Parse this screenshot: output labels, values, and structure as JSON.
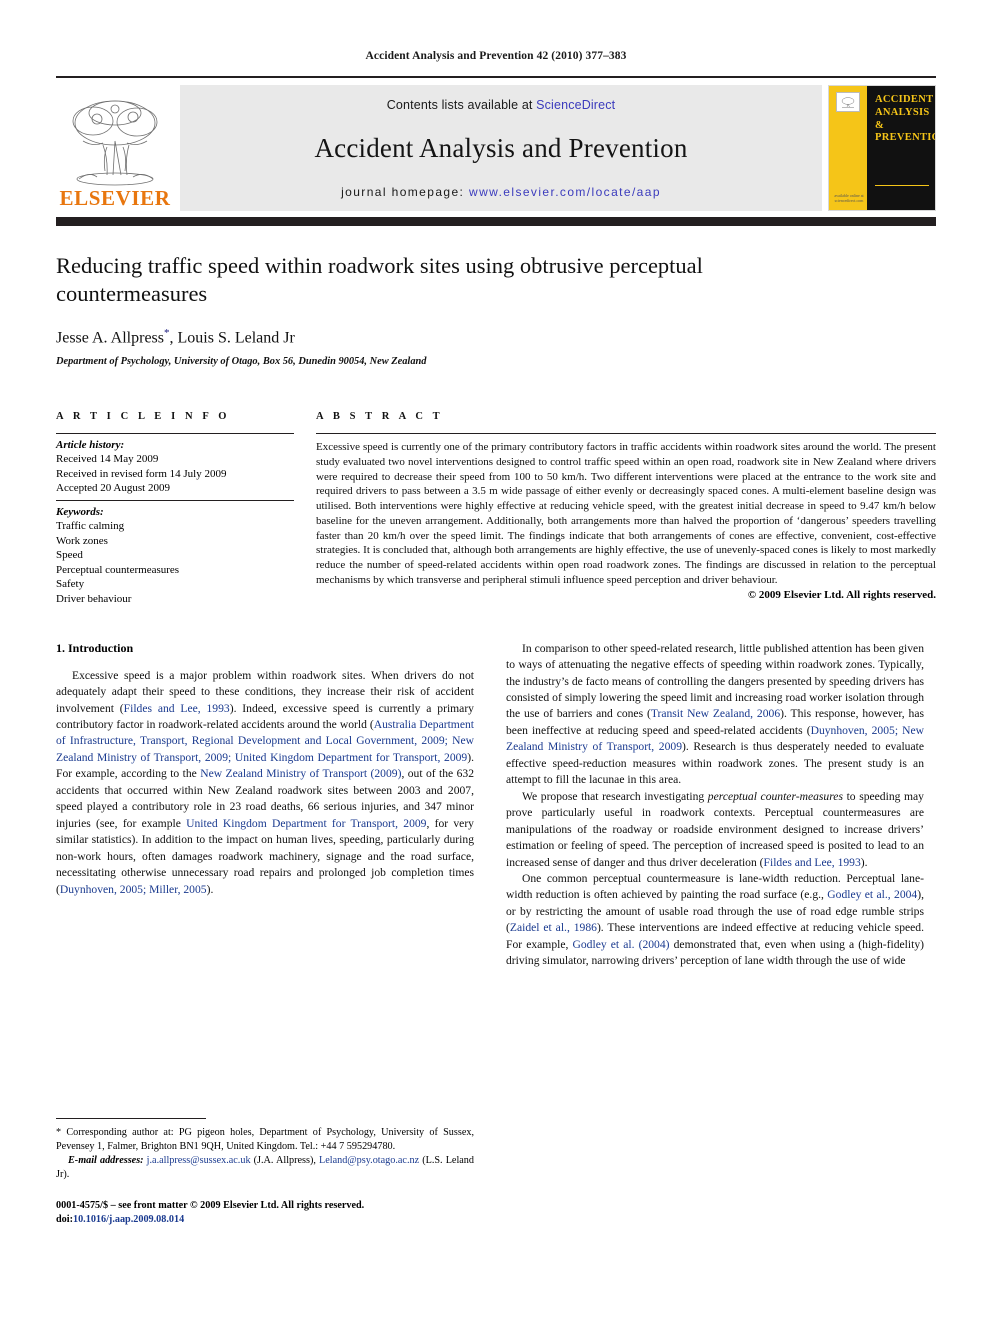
{
  "running_head": "Accident Analysis and Prevention 42 (2010) 377–383",
  "masthead": {
    "publisher_wordmark": "ELSEVIER",
    "contents_prefix": "Contents lists available at ",
    "contents_link": "ScienceDirect",
    "journal_name": "Accident Analysis and Prevention",
    "homepage_prefix": "journal homepage:",
    "homepage_url": "www.elsevier.com/locate/aap",
    "cover_title": "ACCIDENT ANALYSIS & PREVENTION",
    "cover_title_lines": [
      "ACCIDENT",
      "ANALYSIS",
      "&",
      "PREVENTION"
    ],
    "cover_badge": "ELSEVIER",
    "cover_foot": "available online at sciencedirect.com",
    "accent_orange": "#e8760e",
    "accent_yellow": "#f5c518",
    "link_blue": "#3b3bbd",
    "bar_dark": "#231f20"
  },
  "title_block": {
    "title": "Reducing traffic speed within roadwork sites using obtrusive perceptual countermeasures",
    "authors": "Jesse A. Allpress",
    "corresponding_marker": "*",
    "authors_rest": ", Louis S. Leland Jr",
    "affiliation": "Department of Psychology, University of Otago, Box 56, Dunedin 90054, New Zealand"
  },
  "article_info": {
    "label": "A R T I C L E    I N F O",
    "history_label": "Article history:",
    "history": [
      "Received 14 May 2009",
      "Received in revised form 14 July 2009",
      "Accepted 20 August 2009"
    ],
    "keywords_label": "Keywords:",
    "keywords": [
      "Traffic calming",
      "Work zones",
      "Speed",
      "Perceptual countermeasures",
      "Safety",
      "Driver behaviour"
    ]
  },
  "abstract": {
    "label": "A B S T R A C T",
    "text": "Excessive speed is currently one of the primary contributory factors in traffic accidents within roadwork sites around the world. The present study evaluated two novel interventions designed to control traffic speed within an open road, roadwork site in New Zealand where drivers were required to decrease their speed from 100 to 50 km/h. Two different interventions were placed at the entrance to the work site and required drivers to pass between a 3.5 m wide passage of either evenly or decreasingly spaced cones. A multi-element baseline design was utilised. Both interventions were highly effective at reducing vehicle speed, with the greatest initial decrease in speed to 9.47 km/h below baseline for the uneven arrangement. Additionally, both arrangements more than halved the proportion of ‘dangerous’ speeders travelling faster than 20 km/h over the speed limit. The findings indicate that both arrangements of cones are effective, convenient, cost-effective strategies. It is concluded that, although both arrangements are highly effective, the use of unevenly-spaced cones is likely to most markedly reduce the number of speed-related accidents within open road roadwork zones. The findings are discussed in relation to the perceptual mechanisms by which transverse and peripheral stimuli influence speed perception and driver behaviour.",
    "copyright": "© 2009 Elsevier Ltd. All rights reserved."
  },
  "introduction": {
    "heading": "1.  Introduction",
    "left_paragraphs": [
      {
        "segments": [
          {
            "t": "Excessive speed is a major problem within roadwork sites. When drivers do not adequately adapt their speed to these conditions, they increase their risk of accident involvement (",
            "s": "plain"
          },
          {
            "t": "Fildes and Lee, 1993",
            "s": "cite"
          },
          {
            "t": "). Indeed, excessive speed is currently a primary contributory factor in roadwork-related accidents around the world (",
            "s": "plain"
          },
          {
            "t": "Australia Department of Infrastructure, Transport, Regional Development and Local Government, 2009; New Zealand Ministry of Transport, 2009; United Kingdom Department for Transport, 2009",
            "s": "cite"
          },
          {
            "t": "). For example, according to the ",
            "s": "plain"
          },
          {
            "t": "New Zealand Ministry of Transport (2009)",
            "s": "cite"
          },
          {
            "t": ", out of the 632 accidents that occurred within New Zealand roadwork sites between 2003 and 2007, speed played a contributory role in 23 road deaths, 66 serious injuries, and 347 minor injuries (see, for example ",
            "s": "plain"
          },
          {
            "t": "United Kingdom Department for Transport, 2009",
            "s": "cite"
          },
          {
            "t": ", for very similar statistics). In addition to the impact on human lives, speeding, particularly during non-work hours, often damages roadwork machinery, signage and the road surface, necessitating otherwise unnecessary road repairs and prolonged job completion times (",
            "s": "plain"
          },
          {
            "t": "Duynhoven, 2005; Miller, 2005",
            "s": "cite"
          },
          {
            "t": ").",
            "s": "plain"
          }
        ]
      }
    ],
    "right_paragraphs": [
      {
        "segments": [
          {
            "t": "In comparison to other speed-related research, little published attention has been given to ways of attenuating the negative effects of speeding within roadwork zones. Typically, the industry’s de facto means of controlling the dangers presented by speeding drivers has consisted of simply lowering the speed limit and increasing road worker isolation through the use of barriers and cones (",
            "s": "plain"
          },
          {
            "t": "Transit New Zealand, 2006",
            "s": "cite"
          },
          {
            "t": "). This response, however, has been ineffective at reducing speed and speed-related accidents (",
            "s": "plain"
          },
          {
            "t": "Duynhoven, 2005; New Zealand Ministry of Transport, 2009",
            "s": "cite"
          },
          {
            "t": "). Research is thus desperately needed to evaluate effective speed-reduction measures within roadwork zones. The present study is an attempt to fill the lacunae in this area.",
            "s": "plain"
          }
        ]
      },
      {
        "segments": [
          {
            "t": "We propose that research investigating ",
            "s": "plain"
          },
          {
            "t": "perceptual counter-measures",
            "s": "italic"
          },
          {
            "t": " to speeding may prove particularly useful in roadwork contexts. Perceptual countermeasures are manipulations of the roadway or roadside environment designed to increase drivers’ estimation or feeling of speed. The perception of increased speed is posited to lead to an increased sense of danger and thus driver deceleration (",
            "s": "plain"
          },
          {
            "t": "Fildes and Lee, 1993",
            "s": "cite"
          },
          {
            "t": ").",
            "s": "plain"
          }
        ]
      },
      {
        "segments": [
          {
            "t": "One common perceptual countermeasure is lane-width reduction. Perceptual lane-width reduction is often achieved by painting the road surface (e.g., ",
            "s": "plain"
          },
          {
            "t": "Godley et al., 2004",
            "s": "cite"
          },
          {
            "t": "), or by restricting the amount of usable road through the use of road edge rumble strips (",
            "s": "plain"
          },
          {
            "t": "Zaidel et al., 1986",
            "s": "cite"
          },
          {
            "t": "). These interventions are indeed effective at reducing vehicle speed. For example, ",
            "s": "plain"
          },
          {
            "t": "Godley et al. (2004)",
            "s": "cite"
          },
          {
            "t": " demonstrated that, even when using a (high-fidelity) driving simulator, narrowing drivers’ perception of lane width through the use of wide",
            "s": "plain"
          }
        ]
      }
    ]
  },
  "footnote": {
    "segments": [
      {
        "t": "*  Corresponding author at: PG pigeon holes, Department of Psychology, University of Sussex, Pevensey 1, Falmer, Brighton BN1 9QH, United Kingdom. Tel.: +44 7 595294780.",
        "s": "plain"
      }
    ],
    "email_label": "E-mail addresses:",
    "email1": "j.a.allpress@sussex.ac.uk",
    "email1_owner": " (J.A. Allpress),",
    "email2": "Leland@psy.otago.ac.nz",
    "email2_owner": " (L.S. Leland Jr)."
  },
  "imprint": {
    "issn_line": "0001-4575/$ – see front matter © 2009 Elsevier Ltd. All rights reserved.",
    "doi_prefix": "doi:",
    "doi": "10.1016/j.aap.2009.08.014"
  }
}
